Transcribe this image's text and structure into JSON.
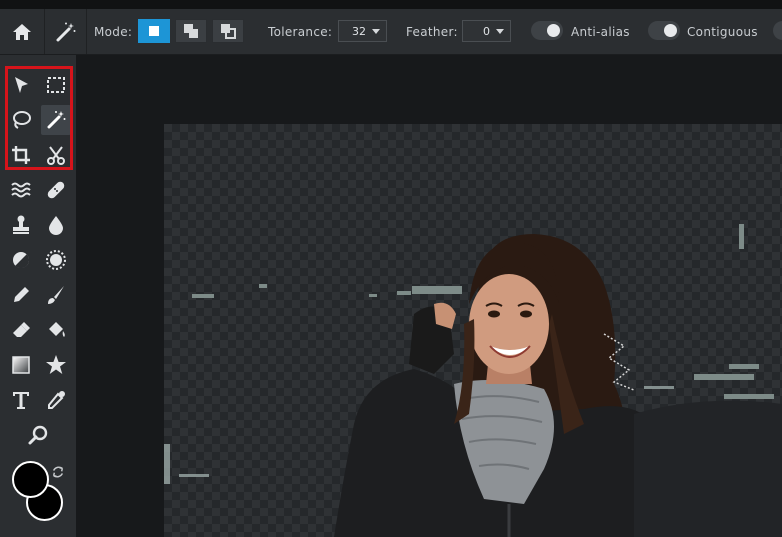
{
  "options_bar": {
    "home_icon": "home-icon",
    "active_tool_icon": "magic-wand-icon",
    "mode_label": "Mode:",
    "mode_buttons": [
      "new-selection-icon",
      "add-to-selection-icon",
      "subtract-from-selection-icon"
    ],
    "tolerance_label": "Tolerance:",
    "tolerance_value": "32",
    "feather_label": "Feather:",
    "feather_value": "0",
    "antialias_label": "Anti-alias",
    "contiguous_label": "Contiguous",
    "accent_color": "#1d95d6"
  },
  "toolbar": {
    "highlight_color": "#d6141b",
    "tools": [
      "move-icon",
      "marquee-icon",
      "lasso-icon",
      "magic-wand-icon",
      "crop-icon",
      "cut-icon",
      "liquify-icon",
      "healing-icon",
      "stamp-icon",
      "drop-icon",
      "dodge-icon",
      "sponge-icon",
      "pencil-icon",
      "brush-icon",
      "eraser-icon",
      "paint-bucket-icon",
      "gradient-icon",
      "shape-icon",
      "text-icon",
      "eyedropper-icon",
      "zoom-icon"
    ],
    "foreground_color": "#000000",
    "background_color": "#000000"
  }
}
